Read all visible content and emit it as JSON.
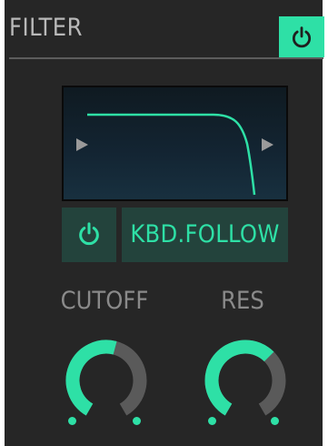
{
  "section": {
    "title": "FILTER",
    "power_icon": "power-icon",
    "power_state": "on",
    "accent_color": "#2ee0a6"
  },
  "filter_display": {
    "shape": "low-pass",
    "prev_icon": "chevron-left-icon",
    "next_icon": "chevron-right-icon"
  },
  "kbd_follow": {
    "power_icon": "power-icon",
    "label": "KBD.FOLLOW"
  },
  "knobs": [
    {
      "label": "CUTOFF",
      "value": 0.55
    },
    {
      "label": "RES",
      "value": 0.65
    }
  ]
}
